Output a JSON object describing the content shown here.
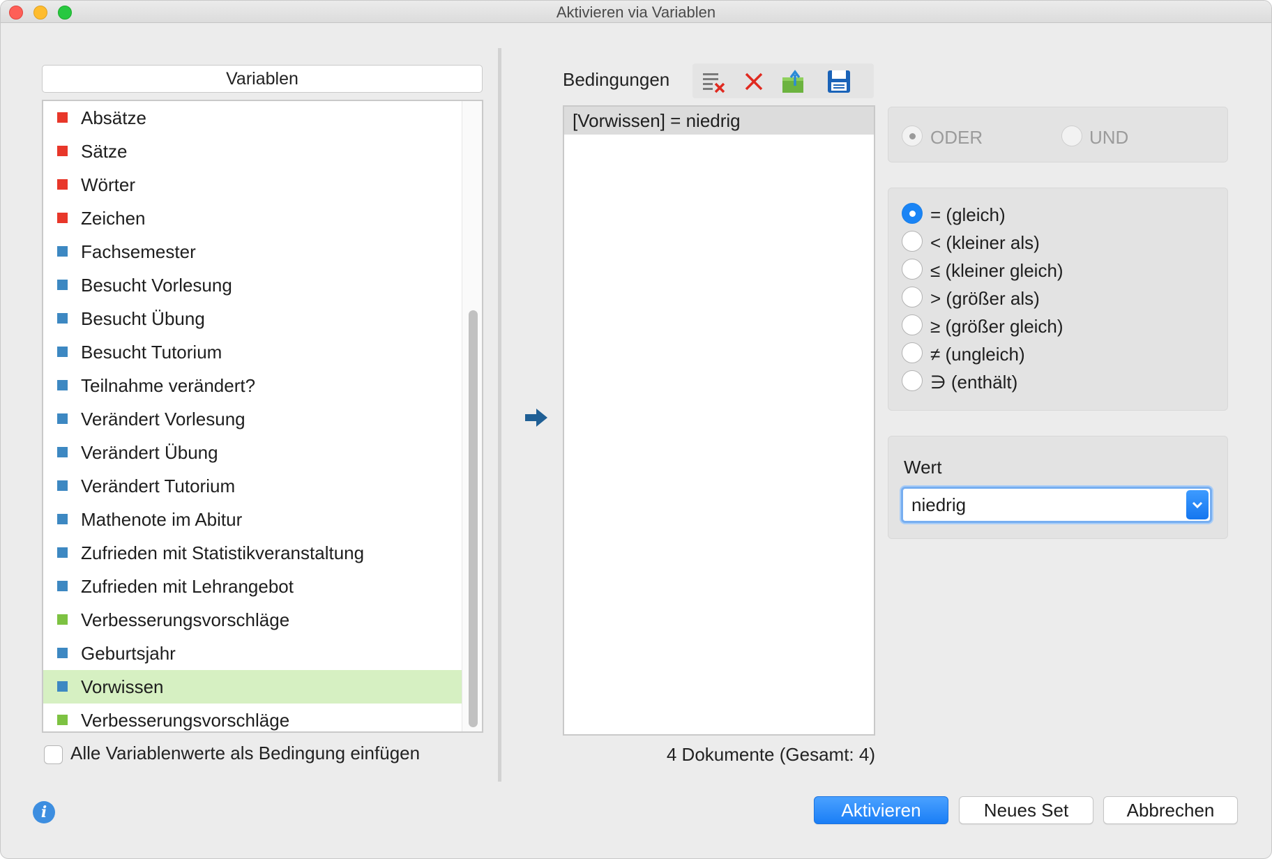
{
  "window": {
    "title": "Aktivieren via Variablen"
  },
  "variables": {
    "header": "Variablen",
    "items": [
      {
        "label": "Absätze",
        "color": "#e8372a"
      },
      {
        "label": "Sätze",
        "color": "#e8372a"
      },
      {
        "label": "Wörter",
        "color": "#e8372a"
      },
      {
        "label": "Zeichen",
        "color": "#e8372a"
      },
      {
        "label": "Fachsemester",
        "color": "#3d88c2"
      },
      {
        "label": "Besucht Vorlesung",
        "color": "#3d88c2"
      },
      {
        "label": "Besucht Übung",
        "color": "#3d88c2"
      },
      {
        "label": "Besucht Tutorium",
        "color": "#3d88c2"
      },
      {
        "label": "Teilnahme verändert?",
        "color": "#3d88c2"
      },
      {
        "label": "Verändert Vorlesung",
        "color": "#3d88c2"
      },
      {
        "label": "Verändert Übung",
        "color": "#3d88c2"
      },
      {
        "label": "Verändert Tutorium",
        "color": "#3d88c2"
      },
      {
        "label": "Mathenote im Abitur",
        "color": "#3d88c2"
      },
      {
        "label": "Zufrieden mit Statistikveranstaltung",
        "color": "#3d88c2"
      },
      {
        "label": "Zufrieden mit Lehrangebot",
        "color": "#3d88c2"
      },
      {
        "label": "Verbesserungsvorschläge",
        "color": "#7dc242"
      },
      {
        "label": "Geburtsjahr",
        "color": "#3d88c2"
      },
      {
        "label": "Vorwissen",
        "color": "#3d88c2",
        "selected": true
      },
      {
        "label": "Verbesserungsvorschläge",
        "color": "#7dc242"
      }
    ],
    "insert_all_label": "Alle Variablenwerte als Bedingung einfügen"
  },
  "conditions": {
    "label": "Bedingungen",
    "items": [
      "[Vorwissen] = niedrig"
    ],
    "doc_count": "4 Dokumente (Gesamt: 4)"
  },
  "logic": {
    "oder": "ODER",
    "und": "UND",
    "selected": "ODER"
  },
  "operators": {
    "items": [
      "= (gleich)",
      "< (kleiner als)",
      "≤ (kleiner gleich)",
      "> (größer als)",
      "≥ (größer gleich)",
      "≠ (ungleich)",
      "∋ (enthält)"
    ],
    "selected": 0
  },
  "value": {
    "label": "Wert",
    "selected": "niedrig"
  },
  "buttons": {
    "activate": "Aktivieren",
    "new_set": "Neues Set",
    "cancel": "Abbrechen"
  },
  "accent": "#1a84f5"
}
